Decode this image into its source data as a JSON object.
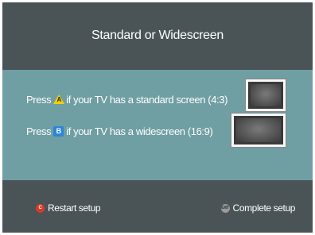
{
  "title": "Standard or Widescreen",
  "options": [
    {
      "prefix": "Press",
      "button": "A",
      "text": "if your TV has a standard screen (4:3)"
    },
    {
      "prefix": "Press",
      "button": "B",
      "text": "if your TV has a widescreen (16:9)"
    }
  ],
  "footer": {
    "restart_button": "C",
    "restart_label": "Restart setup",
    "exit_button": "EXIT",
    "complete_label": "Complete setup"
  },
  "icons": {
    "a_button": "yellow-triangle-icon",
    "b_button": "blue-square-icon",
    "c_button": "red-circle-icon",
    "exit_button": "grey-circle-exit-icon"
  },
  "colors": {
    "background": "#4a5457",
    "panel": "#6f9ea3",
    "text": "#ffffff",
    "yellow": "#f2d000",
    "blue": "#2b86d6",
    "red": "#d83a2a"
  }
}
